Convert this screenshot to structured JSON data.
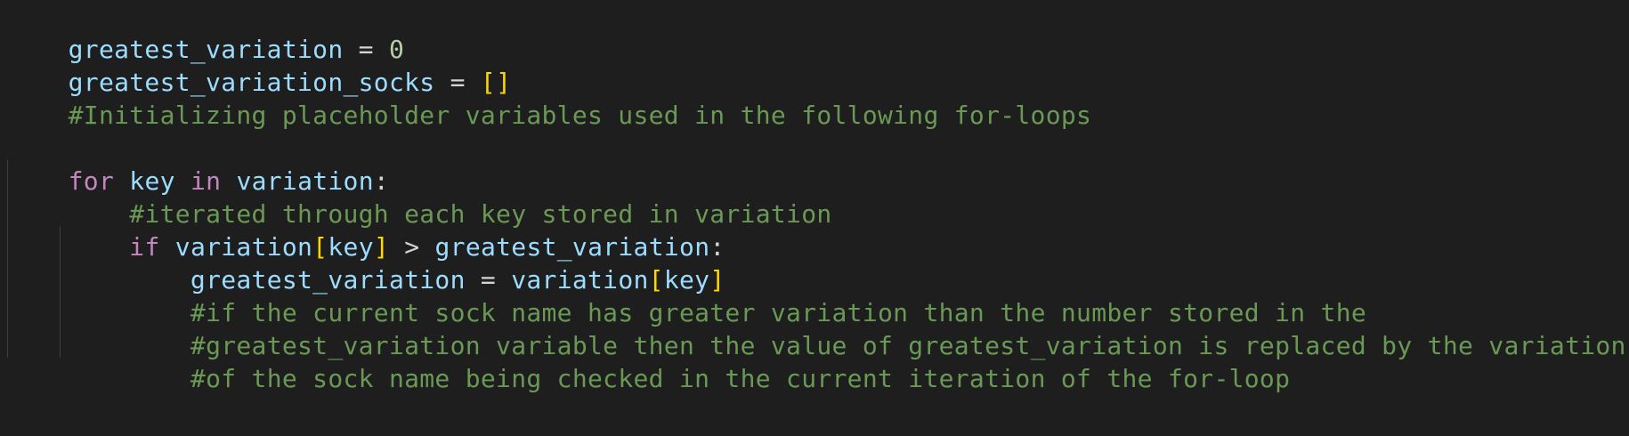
{
  "colors": {
    "background": "#1e1e1e",
    "variable": "#9cdcfe",
    "number": "#b5cea8",
    "operator": "#d4d4d4",
    "keyword": "#c586c0",
    "comment": "#6a9955",
    "bracket": "#ffd700",
    "indent_guide": "#404040"
  },
  "code": {
    "line1": {
      "name": "greatest_variation",
      "op": " = ",
      "value": "0"
    },
    "line2": {
      "name": "greatest_variation_socks",
      "op": " = ",
      "value": "[]"
    },
    "line3": {
      "comment": "#Initializing placeholder variables used in the following for-loops"
    },
    "line5": {
      "kw_for": "for",
      "sp1": " ",
      "key": "key",
      "sp2": " ",
      "kw_in": "in",
      "sp3": " ",
      "iterable": "variation",
      "colon": ":"
    },
    "line6": {
      "indent": "    ",
      "comment": "#iterated through each key stored in variation"
    },
    "line7": {
      "indent": "    ",
      "kw_if": "if",
      "sp1": " ",
      "var": "variation",
      "lb": "[",
      "key": "key",
      "rb": "]",
      "gt": " > ",
      "greatest": "greatest_variation",
      "colon": ":"
    },
    "line8": {
      "indent": "        ",
      "name": "greatest_variation",
      "op": " = ",
      "var": "variation",
      "lb": "[",
      "key": "key",
      "rb": "]"
    },
    "line9": {
      "indent": "        ",
      "comment": "#if the current sock name has greater variation than the number stored in the"
    },
    "line10": {
      "indent": "        ",
      "comment": "#greatest_variation variable then the value of greatest_variation is replaced by the variation"
    },
    "line11": {
      "indent": "        ",
      "comment": "#of the sock name being checked in the current iteration of the for-loop"
    }
  }
}
